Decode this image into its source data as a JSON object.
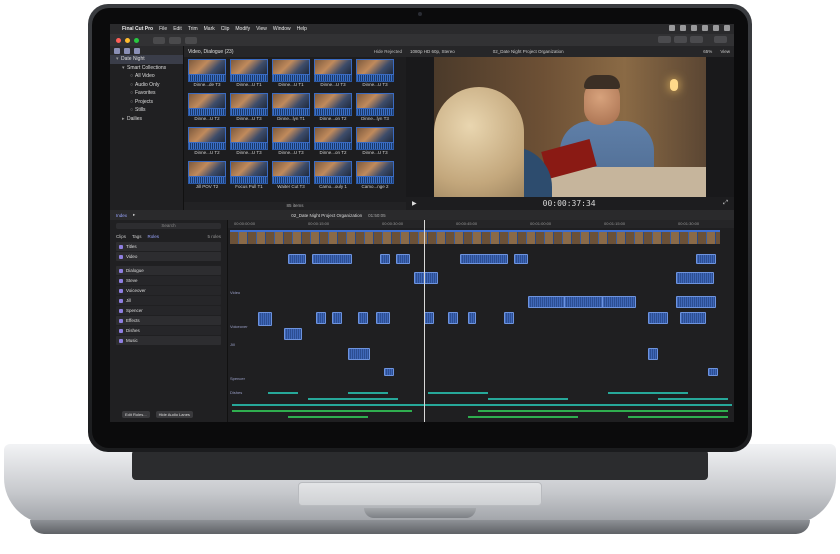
{
  "menubar": {
    "app": "Final Cut Pro",
    "items": [
      "File",
      "Edit",
      "Trim",
      "Mark",
      "Clip",
      "Modify",
      "View",
      "Window",
      "Help"
    ]
  },
  "library": {
    "name": "Date Night",
    "items": [
      {
        "label": "Smart Collections",
        "indent": 1
      },
      {
        "label": "All Video",
        "indent": 2
      },
      {
        "label": "Audio Only",
        "indent": 2
      },
      {
        "label": "Favorites",
        "indent": 2
      },
      {
        "label": "Projects",
        "indent": 2
      },
      {
        "label": "Stills",
        "indent": 2
      },
      {
        "label": "Dailies",
        "indent": 1
      }
    ]
  },
  "browser": {
    "title": "Video, Dialogue",
    "count": "(23)",
    "filter": "Hide Rejected",
    "clips": [
      "Dinne...de T3",
      "Dinne...U T1",
      "Dinne...U T1",
      "Dinne...U T3",
      "Dinne...U T3",
      "Dinne...U T2",
      "Dinne...U T3",
      "Dinne...lyn T1",
      "Dinne...on T2",
      "Dinne...lyn T3",
      "Dinne...U T2",
      "Dinne...U T3",
      "Dinne...U T3",
      "Dinne...on T2",
      "Dinne...U T3",
      "Jill POV T2",
      "Focus Pull T1",
      "Waiter Cut T3",
      "Camo...ouly 1",
      "Camo...nge 2"
    ],
    "footer": "85 items"
  },
  "viewer": {
    "format": "1080p HD 60p, Stereo",
    "project": "02_Date Night Project Organization",
    "zoom": "65%",
    "view": "View",
    "timecode": "00:00:37:34"
  },
  "timeline": {
    "index_label": "Index",
    "project": "02_Date Night Project Organization",
    "duration": "01:50:05",
    "ruler": [
      "00:00:00:00",
      "00:00:15:00",
      "00:00:30:00",
      "00:00:45:00",
      "00:01:00:00",
      "00:01:15:00",
      "00:01:30:00"
    ],
    "lanes": [
      "Video",
      "Voiceover",
      "Jill",
      "Spencer",
      "Dishes"
    ]
  },
  "index": {
    "search": "Search",
    "tabs": [
      "Clips",
      "Tags",
      "Roles"
    ],
    "active_tab": "Roles",
    "count": "5 roles",
    "roles": [
      {
        "label": "Titles",
        "sub": false,
        "gap": false
      },
      {
        "label": "Video",
        "sub": false,
        "gap": false
      },
      {
        "label": "Dialogue",
        "sub": false,
        "gap": true
      },
      {
        "label": "Steve",
        "sub": true,
        "gap": false
      },
      {
        "label": "Voiceover",
        "sub": true,
        "gap": false
      },
      {
        "label": "Jill",
        "sub": true,
        "gap": false
      },
      {
        "label": "Spencer",
        "sub": true,
        "gap": false
      },
      {
        "label": "Effects",
        "sub": false,
        "gap": false
      },
      {
        "label": "Dishes",
        "sub": true,
        "gap": false
      },
      {
        "label": "Music",
        "sub": false,
        "gap": false
      }
    ],
    "edit_roles": "Edit Roles...",
    "hide_lanes": "Hide Audio Lanes"
  },
  "colors": {
    "accent": "#3f6fd0",
    "role_purple": "#8f7fe0",
    "teal": "#27a89a",
    "green": "#2fae4f"
  }
}
